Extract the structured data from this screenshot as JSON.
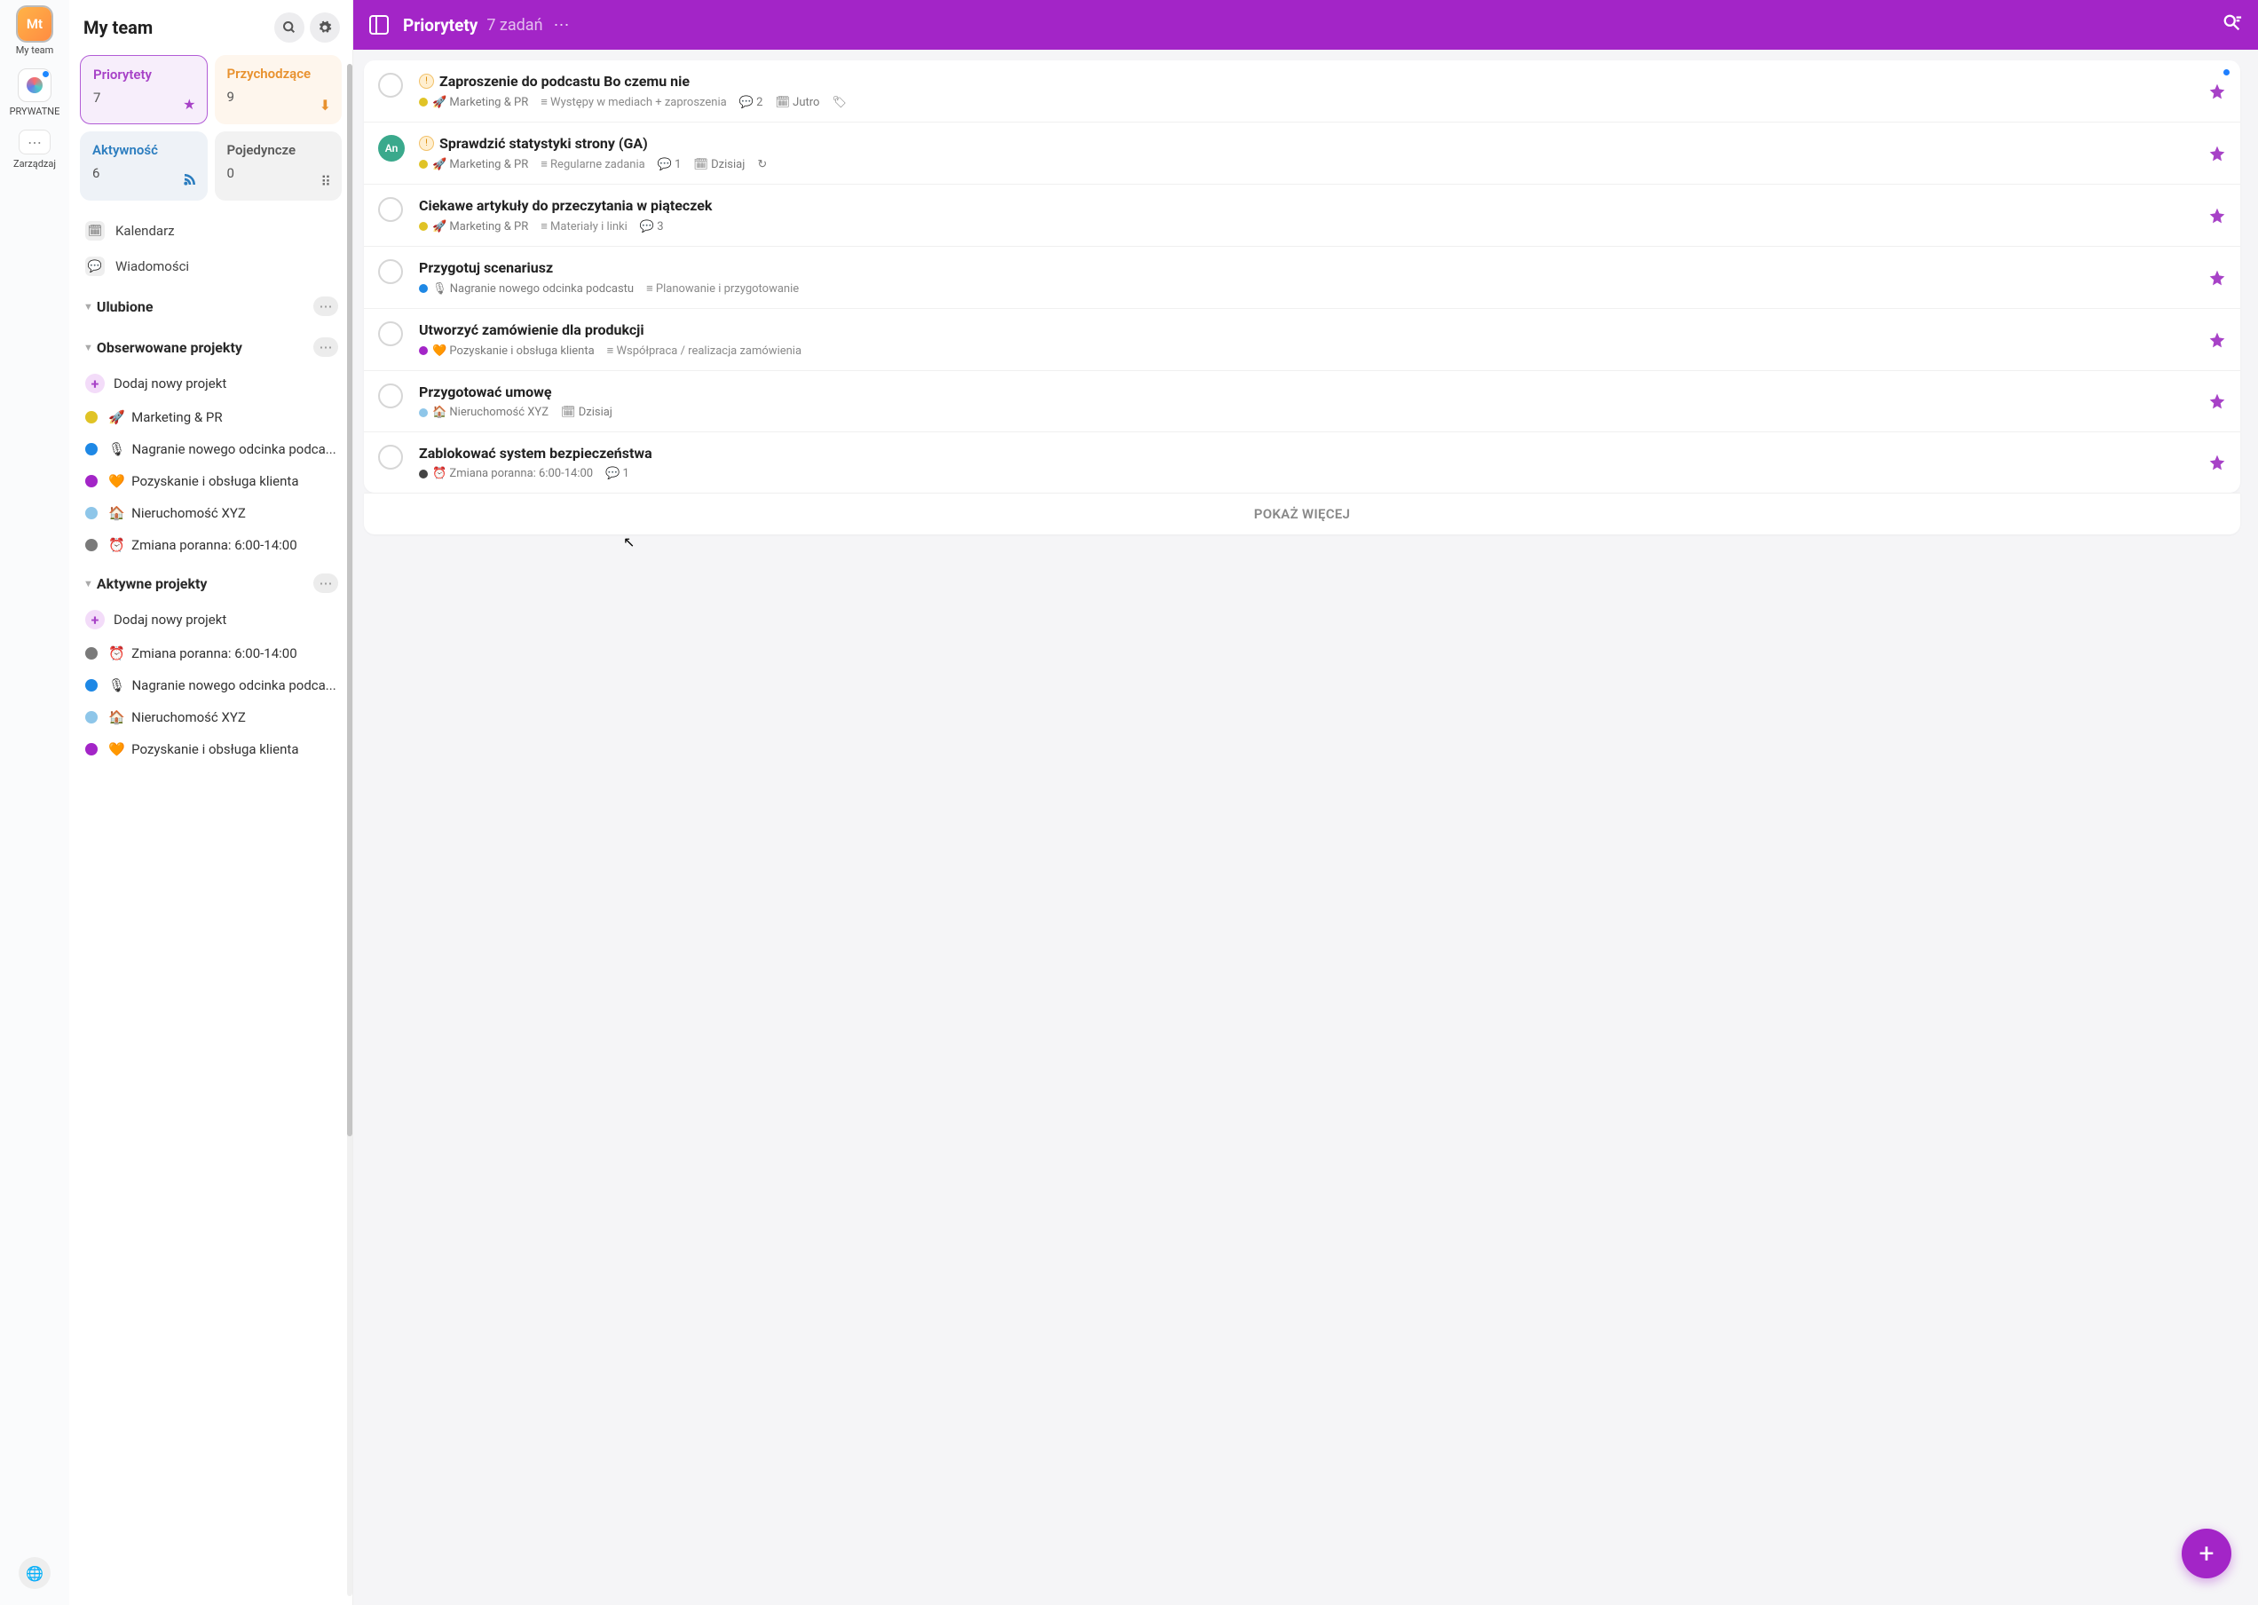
{
  "rail": {
    "team": {
      "avatar_text": "Mt",
      "label": "My team"
    },
    "private": {
      "label": "PRYWATNE"
    },
    "manage": {
      "label": "Zarządzaj"
    }
  },
  "sidebar": {
    "title": "My team",
    "cards": {
      "priorities": {
        "title": "Priorytety",
        "count": "7"
      },
      "incoming": {
        "title": "Przychodzące",
        "count": "9"
      },
      "activity": {
        "title": "Aktywność",
        "count": "6"
      },
      "single": {
        "title": "Pojedyncze",
        "count": "0"
      }
    },
    "calendar": "Kalendarz",
    "messages": "Wiadomości",
    "sections": {
      "favorites": "Ulubione",
      "watched": "Obserwowane projekty",
      "active": "Aktywne projekty"
    },
    "add_project": "Dodaj nowy projekt",
    "watched_projects": [
      {
        "dot": "dot-yellow",
        "emoji": "🚀",
        "name": "Marketing & PR"
      },
      {
        "dot": "dot-blue",
        "emoji": "🎙",
        "name": "Nagranie nowego odcinka podca..."
      },
      {
        "dot": "dot-purple",
        "emoji": "🧡",
        "name": "Pozyskanie i obsługa klienta"
      },
      {
        "dot": "dot-lblue",
        "emoji": "🏠",
        "name": "Nieruchomość XYZ"
      },
      {
        "dot": "dot-grey",
        "emoji": "⏰",
        "name": "Zmiana poranna: 6:00-14:00"
      }
    ],
    "active_projects": [
      {
        "dot": "dot-grey",
        "emoji": "⏰",
        "name": "Zmiana poranna: 6:00-14:00"
      },
      {
        "dot": "dot-blue",
        "emoji": "🎙",
        "name": "Nagranie nowego odcinka podca..."
      },
      {
        "dot": "dot-lblue",
        "emoji": "🏠",
        "name": "Nieruchomość XYZ"
      },
      {
        "dot": "dot-purple",
        "emoji": "🧡",
        "name": "Pozyskanie i obsługa klienta"
      }
    ]
  },
  "header": {
    "title": "Priorytety",
    "count": "7 zadań"
  },
  "tasks": [
    {
      "expiring": true,
      "avatar": "",
      "unread": true,
      "title": "Zaproszenie do podcastu Bo czemu nie",
      "project": {
        "dot": "dot-yellow",
        "emoji": "🚀",
        "name": "Marketing & PR"
      },
      "section": "Występy w mediach + zaproszenia",
      "comments": "2",
      "date": "Jutro",
      "tag": true
    },
    {
      "expiring": true,
      "avatar": "An",
      "unread": false,
      "title": "Sprawdzić statystyki strony (GA)",
      "project": {
        "dot": "dot-yellow",
        "emoji": "🚀",
        "name": "Marketing & PR"
      },
      "section": "Regularne zadania",
      "comments": "1",
      "date": "Dzisiaj",
      "repeat": true
    },
    {
      "avatar": "",
      "title": "Ciekawe artykuły do przeczytania w piąteczek",
      "project": {
        "dot": "dot-yellow",
        "emoji": "🚀",
        "name": "Marketing & PR"
      },
      "section": "Materiały i linki",
      "comments": "3"
    },
    {
      "avatar": "",
      "title": "Przygotuj scenariusz",
      "project": {
        "dot": "dot-blue",
        "emoji": "🎙",
        "name": "Nagranie nowego odcinka podcastu"
      },
      "section": "Planowanie i przygotowanie"
    },
    {
      "avatar": "",
      "title": "Utworzyć zamówienie dla produkcji",
      "project": {
        "dot": "dot-purple",
        "emoji": "🧡",
        "name": "Pozyskanie i obsługa klienta"
      },
      "section": "Współpraca / realizacja zamówienia"
    },
    {
      "avatar": "",
      "title": "Przygotować umowę",
      "project": {
        "dot": "dot-lblue",
        "emoji": "🏠",
        "name": "Nieruchomość XYZ"
      },
      "date": "Dzisiaj"
    },
    {
      "avatar": "",
      "title": "Zablokować system bezpieczeństwa",
      "project": {
        "dot": "dot-dgrey",
        "emoji": "⏰",
        "name": "Zmiana poranna: 6:00-14:00"
      },
      "comments": "1"
    }
  ],
  "show_more": "POKAŻ WIĘCEJ"
}
